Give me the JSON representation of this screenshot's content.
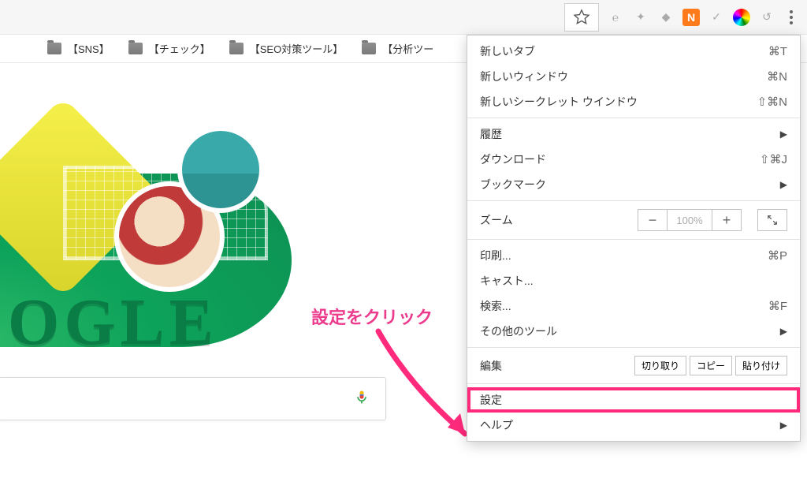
{
  "bookmarks": {
    "items": [
      {
        "label": "【SNS】"
      },
      {
        "label": "【チェック】"
      },
      {
        "label": "【SEO対策ツール】"
      },
      {
        "label": "【分析ツー"
      }
    ]
  },
  "doodle": {
    "letters": "OGLE"
  },
  "annotation": {
    "text": "設定をクリック"
  },
  "menu": {
    "section1": {
      "new_tab": {
        "label": "新しいタブ",
        "shortcut": "⌘T"
      },
      "new_window": {
        "label": "新しいウィンドウ",
        "shortcut": "⌘N"
      },
      "new_incognito": {
        "label": "新しいシークレット ウインドウ",
        "shortcut": "⇧⌘N"
      }
    },
    "section2": {
      "history": {
        "label": "履歴"
      },
      "downloads": {
        "label": "ダウンロード",
        "shortcut": "⇧⌘J"
      },
      "bookmarks": {
        "label": "ブックマーク"
      }
    },
    "zoom": {
      "label": "ズーム",
      "value": "100%"
    },
    "section3": {
      "print": {
        "label": "印刷...",
        "shortcut": "⌘P"
      },
      "cast": {
        "label": "キャスト..."
      },
      "find": {
        "label": "検索...",
        "shortcut": "⌘F"
      },
      "more_tools": {
        "label": "その他のツール"
      }
    },
    "edit": {
      "label": "編集",
      "cut": "切り取り",
      "copy": "コピー",
      "paste": "貼り付け"
    },
    "section4": {
      "settings": {
        "label": "設定"
      },
      "help": {
        "label": "ヘルプ"
      }
    }
  }
}
